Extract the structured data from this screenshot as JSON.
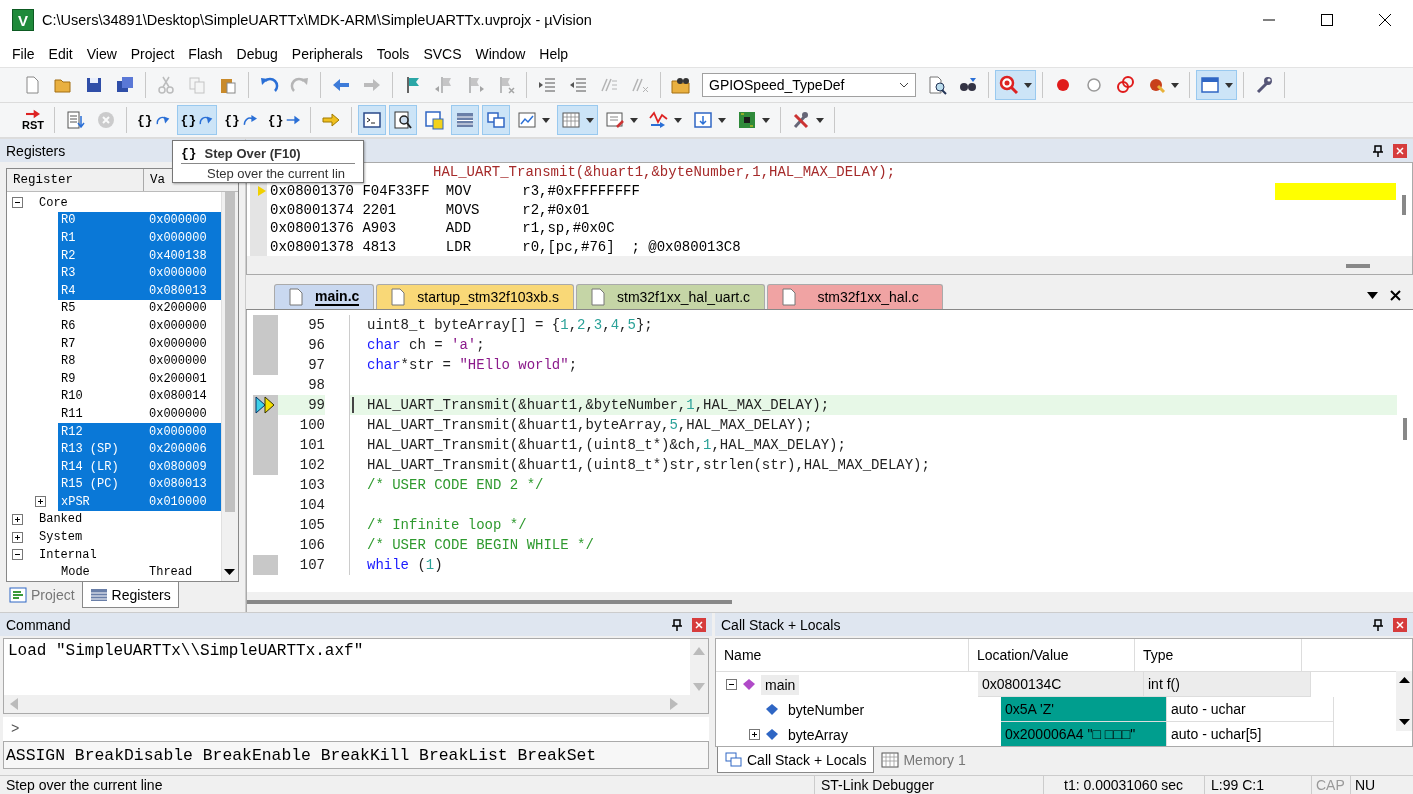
{
  "window": {
    "logo": "V",
    "title": "C:\\Users\\34891\\Desktop\\SimpleUARTTx\\MDK-ARM\\SimpleUARTTx.uvprojx - µVision"
  },
  "menu": [
    "File",
    "Edit",
    "View",
    "Project",
    "Flash",
    "Debug",
    "Peripherals",
    "Tools",
    "SVCS",
    "Window",
    "Help"
  ],
  "toolbar_1": [
    {
      "buttons": [
        {
          "kind": "new",
          "disabled": false,
          "on": false
        },
        {
          "kind": "open",
          "disabled": false,
          "on": false
        },
        {
          "kind": "save",
          "disabled": false,
          "on": false
        },
        {
          "kind": "saveall",
          "disabled": false,
          "on": false
        }
      ]
    },
    {
      "buttons": [
        {
          "kind": "cut",
          "disabled": true,
          "on": false
        },
        {
          "kind": "copy",
          "disabled": true,
          "on": false
        },
        {
          "kind": "paste",
          "disabled": false,
          "on": false
        }
      ]
    },
    {
      "buttons": [
        {
          "kind": "undo",
          "disabled": false,
          "on": false
        },
        {
          "kind": "redo",
          "disabled": true,
          "on": false
        }
      ]
    },
    {
      "buttons": [
        {
          "kind": "back",
          "disabled": false,
          "on": false
        },
        {
          "kind": "forward",
          "disabled": true,
          "on": false
        }
      ]
    },
    {
      "buttons": [
        {
          "kind": "bookmark",
          "disabled": false,
          "on": false
        },
        {
          "kind": "bmprev",
          "disabled": true,
          "on": false
        },
        {
          "kind": "bmnext",
          "disabled": true,
          "on": false
        },
        {
          "kind": "bmclear",
          "disabled": true,
          "on": false
        }
      ]
    },
    {
      "buttons": [
        {
          "kind": "indent",
          "disabled": false,
          "on": false
        },
        {
          "kind": "unindent",
          "disabled": false,
          "on": false
        },
        {
          "kind": "comment",
          "disabled": true,
          "on": false
        },
        {
          "kind": "uncomment",
          "disabled": true,
          "on": false
        }
      ]
    },
    {
      "buttons": [
        {
          "kind": "findfolder",
          "disabled": false,
          "on": false
        },
        {
          "kind": "combo",
          "value": "GPIOSpeed_TypeDef"
        },
        {
          "kind": "finddoc",
          "disabled": false,
          "on": false
        },
        {
          "kind": "findnext",
          "disabled": false,
          "on": false
        }
      ]
    },
    {
      "buttons": [
        {
          "kind": "debug",
          "disabled": false,
          "on": true
        }
      ]
    },
    {
      "buttons": [
        {
          "kind": "bp",
          "disabled": false,
          "on": false
        },
        {
          "kind": "bpoff",
          "disabled": false,
          "on": false
        },
        {
          "kind": "bpkill",
          "disabled": false,
          "on": false
        },
        {
          "kind": "bpall",
          "disabled": false,
          "on": false
        }
      ]
    },
    {
      "buttons": [
        {
          "kind": "window",
          "disabled": false,
          "on": true
        }
      ]
    },
    {
      "buttons": [
        {
          "kind": "wrench",
          "disabled": false,
          "on": false
        }
      ]
    }
  ],
  "toolbar_2": [
    {
      "buttons": [
        {
          "kind": "rst",
          "label": "RST",
          "disabled": false,
          "on": false
        }
      ]
    },
    {
      "buttons": [
        {
          "kind": "run",
          "disabled": false,
          "on": false
        },
        {
          "kind": "stop",
          "disabled": true,
          "on": false
        }
      ]
    },
    {
      "buttons": [
        {
          "kind": "stepin",
          "label": "{}",
          "disabled": false,
          "on": false
        },
        {
          "kind": "stepover",
          "label": "{}",
          "disabled": false,
          "on": true
        },
        {
          "kind": "stepout",
          "label": "{}",
          "disabled": false,
          "on": false
        },
        {
          "kind": "runto",
          "label": "{}",
          "disabled": false,
          "on": false
        }
      ]
    },
    {
      "buttons": [
        {
          "kind": "shownext",
          "disabled": false,
          "on": false
        }
      ]
    },
    {
      "buttons": [
        {
          "kind": "cmd",
          "disabled": false,
          "on": true
        },
        {
          "kind": "disasm",
          "disabled": false,
          "on": true
        },
        {
          "kind": "symbols",
          "disabled": false,
          "on": false
        },
        {
          "kind": "regs",
          "disabled": false,
          "on": true
        },
        {
          "kind": "callstack",
          "disabled": false,
          "on": true
        },
        {
          "kind": "watch",
          "disabled": false,
          "on": false
        },
        {
          "kind": "memory",
          "disabled": false,
          "on": true
        },
        {
          "kind": "serial",
          "disabled": false,
          "on": false
        },
        {
          "kind": "analysis",
          "disabled": false,
          "on": false
        },
        {
          "kind": "trace",
          "disabled": false,
          "on": false
        },
        {
          "kind": "sysview",
          "disabled": false,
          "on": false
        }
      ]
    },
    {
      "buttons": [
        {
          "kind": "tools",
          "disabled": false,
          "on": false
        }
      ]
    }
  ],
  "tooltip": {
    "icon": "{}",
    "title": "Step Over (F10)",
    "text": "Step over the current lin"
  },
  "registers_panel": {
    "title": "Registers",
    "columns": [
      "Register",
      "Va"
    ],
    "tree": [
      {
        "name": "Core",
        "expanded": true,
        "selected": false,
        "children": [
          {
            "name": "R0",
            "value": "0x000000",
            "selected": true
          },
          {
            "name": "R1",
            "value": "0x000000",
            "selected": true
          },
          {
            "name": "R2",
            "value": "0x400138",
            "selected": true
          },
          {
            "name": "R3",
            "value": "0x000000",
            "selected": true
          },
          {
            "name": "R4",
            "value": "0x080013",
            "selected": true
          },
          {
            "name": "R5",
            "value": "0x200000",
            "selected": false
          },
          {
            "name": "R6",
            "value": "0x000000",
            "selected": false
          },
          {
            "name": "R7",
            "value": "0x000000",
            "selected": false
          },
          {
            "name": "R8",
            "value": "0x000000",
            "selected": false
          },
          {
            "name": "R9",
            "value": "0x200001",
            "selected": false
          },
          {
            "name": "R10",
            "value": "0x080014",
            "selected": false
          },
          {
            "name": "R11",
            "value": "0x000000",
            "selected": false
          },
          {
            "name": "R12",
            "value": "0x000000",
            "selected": true
          },
          {
            "name": "R13 (SP)",
            "value": "0x200006",
            "selected": true
          },
          {
            "name": "R14 (LR)",
            "value": "0x080009",
            "selected": true
          },
          {
            "name": "R15 (PC)",
            "value": "0x080013",
            "selected": true
          },
          {
            "name": "xPSR",
            "value": "0x010000",
            "selected": true,
            "expanded": false
          }
        ]
      },
      {
        "name": "Banked",
        "expanded": false,
        "selected": false
      },
      {
        "name": "System",
        "expanded": false,
        "selected": false
      },
      {
        "name": "Internal",
        "expanded": true,
        "selected": false,
        "children": [
          {
            "name": "Mode",
            "value": "Thread",
            "selected": false
          }
        ]
      }
    ],
    "tabs": [
      {
        "label": "Project",
        "selected": false
      },
      {
        "label": "Registers",
        "selected": true
      }
    ]
  },
  "disassembly": {
    "source": "HAL_UART_Transmit(&huart1,&byteNumber,1,HAL_MAX_DELAY);",
    "rows": [
      {
        "address": "0x08001370",
        "opcode": "F04F33FF",
        "mnemonic": "MOV",
        "operands": "r3,#0xFFFFFFFF",
        "current": true
      },
      {
        "address": "0x08001374",
        "opcode": "2201",
        "mnemonic": "MOVS",
        "operands": "r2,#0x01",
        "current": false
      },
      {
        "address": "0x08001376",
        "opcode": "A903",
        "mnemonic": "ADD",
        "operands": "r1,sp,#0x0C",
        "current": false
      },
      {
        "address": "0x08001378",
        "opcode": "4813",
        "mnemonic": "LDR",
        "operands": "r0,[pc,#76]  ; @0x080013C8",
        "current": false
      }
    ]
  },
  "editor": {
    "tabs": [
      {
        "label": "main.c",
        "selected": true,
        "color": "#c9d8f0"
      },
      {
        "label": "startup_stm32f103xb.s",
        "selected": false,
        "color": "#f9d877"
      },
      {
        "label": "stm32f1xx_hal_uart.c",
        "selected": false,
        "color": "#c5d5a6"
      },
      {
        "label": "stm32f1xx_hal.c",
        "selected": false,
        "color": "#f0a3a3"
      }
    ],
    "lines": [
      {
        "number": "95",
        "executable": true,
        "current": false,
        "tokens": [
          {
            "kind": "plain",
            "text": "uint8_t byteArray[] = {"
          },
          {
            "kind": "number",
            "text": "1"
          },
          {
            "kind": "plain",
            "text": ","
          },
          {
            "kind": "number",
            "text": "2"
          },
          {
            "kind": "plain",
            "text": ","
          },
          {
            "kind": "number",
            "text": "3"
          },
          {
            "kind": "plain",
            "text": ","
          },
          {
            "kind": "number",
            "text": "4"
          },
          {
            "kind": "plain",
            "text": ","
          },
          {
            "kind": "number",
            "text": "5"
          },
          {
            "kind": "plain",
            "text": "};"
          }
        ]
      },
      {
        "number": "96",
        "executable": true,
        "current": false,
        "tokens": [
          {
            "kind": "keyword",
            "text": "char"
          },
          {
            "kind": "plain",
            "text": " ch = "
          },
          {
            "kind": "string",
            "text": "'a'"
          },
          {
            "kind": "plain",
            "text": ";"
          }
        ]
      },
      {
        "number": "97",
        "executable": true,
        "current": false,
        "tokens": [
          {
            "kind": "keyword",
            "text": "char"
          },
          {
            "kind": "plain",
            "text": "*str = "
          },
          {
            "kind": "string",
            "text": "\"HEllo world\""
          },
          {
            "kind": "plain",
            "text": ";"
          }
        ]
      },
      {
        "number": "98",
        "executable": false,
        "current": false
      },
      {
        "number": "99",
        "executable": true,
        "current": true,
        "tokens": [
          {
            "kind": "plain",
            "text": "HAL_UART_Transmit(&huart1,&byteNumber,"
          },
          {
            "kind": "number",
            "text": "1"
          },
          {
            "kind": "plain",
            "text": ",HAL_MAX_DELAY);"
          }
        ]
      },
      {
        "number": "100",
        "executable": true,
        "current": false,
        "tokens": [
          {
            "kind": "plain",
            "text": "HAL_UART_Transmit(&huart1,byteArray,"
          },
          {
            "kind": "number",
            "text": "5"
          },
          {
            "kind": "plain",
            "text": ",HAL_MAX_DELAY);"
          }
        ]
      },
      {
        "number": "101",
        "executable": true,
        "current": false,
        "tokens": [
          {
            "kind": "plain",
            "text": "HAL_UART_Transmit(&huart1,(uint8_t*)&ch,"
          },
          {
            "kind": "number",
            "text": "1"
          },
          {
            "kind": "plain",
            "text": ",HAL_MAX_DELAY);"
          }
        ]
      },
      {
        "number": "102",
        "executable": true,
        "current": false,
        "tokens": [
          {
            "kind": "plain",
            "text": "HAL_UART_Transmit(&huart1,(uint8_t*)str,strlen(str),HAL_MAX_DELAY);"
          }
        ]
      },
      {
        "number": "103",
        "executable": false,
        "current": false,
        "tokens": [
          {
            "kind": "comment",
            "text": "/* USER CODE END 2 */"
          }
        ]
      },
      {
        "number": "104",
        "executable": false,
        "current": false
      },
      {
        "number": "105",
        "executable": false,
        "current": false,
        "tokens": [
          {
            "kind": "comment",
            "text": "/* Infinite loop */"
          }
        ]
      },
      {
        "number": "106",
        "executable": false,
        "current": false,
        "tokens": [
          {
            "kind": "comment",
            "text": "/* USER CODE BEGIN WHILE */"
          }
        ]
      },
      {
        "number": "107",
        "executable": true,
        "current": false,
        "tokens": [
          {
            "kind": "keyword",
            "text": "while"
          },
          {
            "kind": "plain",
            "text": " ("
          },
          {
            "kind": "number",
            "text": "1"
          },
          {
            "kind": "plain",
            "text": ")"
          }
        ]
      }
    ]
  },
  "command": {
    "title": "Command",
    "output": "Load \"SimpleUARTTx\\\\SimpleUARTTx.axf\"",
    "prompt": ">",
    "hints": "ASSIGN BreakDisable BreakEnable BreakKill BreakList BreakSet"
  },
  "call_stack": {
    "title": "Call Stack + Locals",
    "columns": [
      "Name",
      "Location/Value",
      "Type"
    ],
    "rows": [
      {
        "kind": "function",
        "name": "main",
        "value": "0x0800134C",
        "type": "int f()",
        "expanded": true,
        "changed": false,
        "children": [
          {
            "kind": "variable",
            "name": "byteNumber",
            "value": "0x5A 'Z'",
            "type": "auto - uchar",
            "changed": true
          },
          {
            "kind": "variable",
            "name": "byteArray",
            "value": "0x200006A4 \"□ □□□\"",
            "type": "auto - uchar[5]",
            "changed": true,
            "expanded": false
          }
        ]
      }
    ],
    "tabs": [
      {
        "label": "Call Stack + Locals",
        "selected": true
      },
      {
        "label": "Memory 1",
        "selected": false
      }
    ]
  },
  "status_bar": {
    "message": "Step over the current line",
    "debugger": "ST-Link Debugger",
    "time": "t1: 0.00031060 sec",
    "position": "L:99 C:1",
    "indicators": [
      {
        "label": "CAP",
        "on": false
      },
      {
        "label": "NU",
        "on": true
      }
    ]
  }
}
